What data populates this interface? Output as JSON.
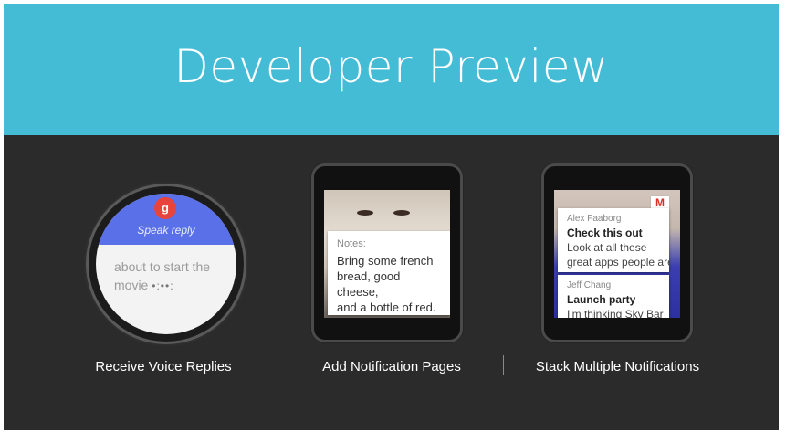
{
  "banner": {
    "title": "Developer Preview"
  },
  "sections": [
    {
      "caption": "Receive Voice Replies"
    },
    {
      "caption": "Add Notification Pages"
    },
    {
      "caption": "Stack Multiple Notifications"
    }
  ],
  "voice_watch": {
    "badge": "g",
    "prompt": "Speak reply",
    "transcript_line1": "about to start the",
    "transcript_line2": "movie",
    "dots": "•:••:"
  },
  "notes_watch": {
    "label": "Notes:",
    "line1": "Bring some french",
    "line2": "bread, good cheese,",
    "line3": "and a bottle of red."
  },
  "stack_watch": {
    "app_icon": "M",
    "notifications": [
      {
        "sender": "Alex Faaborg",
        "subject": "Check this out",
        "preview": "Look at all these",
        "preview2": "great apps people are"
      },
      {
        "sender": "Jeff Chang",
        "subject": "Launch party",
        "preview": "I'm thinking Sky Bar"
      }
    ]
  },
  "colors": {
    "banner": "#45bcd6",
    "background": "#2b2b2b",
    "voice_accent": "#5a70e9",
    "mic_badge": "#e9443b"
  }
}
